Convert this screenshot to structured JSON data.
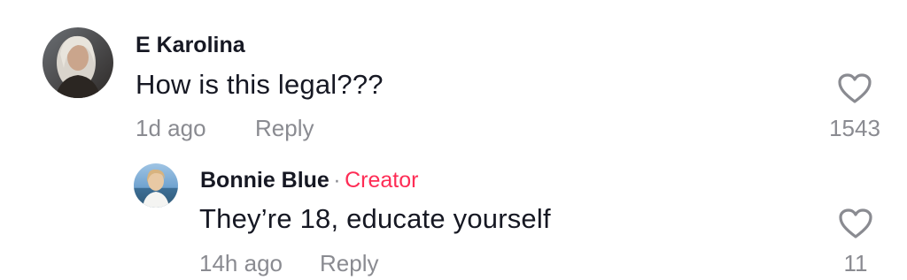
{
  "comments": [
    {
      "username": "E Karolina",
      "text": "How is this legal???",
      "time": "1d ago",
      "reply_label": "Reply",
      "likes": "1543",
      "avatar_icon": "user-avatar-photo"
    }
  ],
  "replies": [
    {
      "username": "Bonnie Blue",
      "separator": "·",
      "badge": "Creator",
      "text": "They’re 18, educate yourself",
      "time": "14h ago",
      "reply_label": "Reply",
      "likes": "11",
      "avatar_icon": "user-avatar-photo"
    }
  ],
  "colors": {
    "text": "#161823",
    "muted": "#8a8b91",
    "creator_accent": "#fe2c55"
  },
  "icons": {
    "like": "heart-outline-icon"
  }
}
